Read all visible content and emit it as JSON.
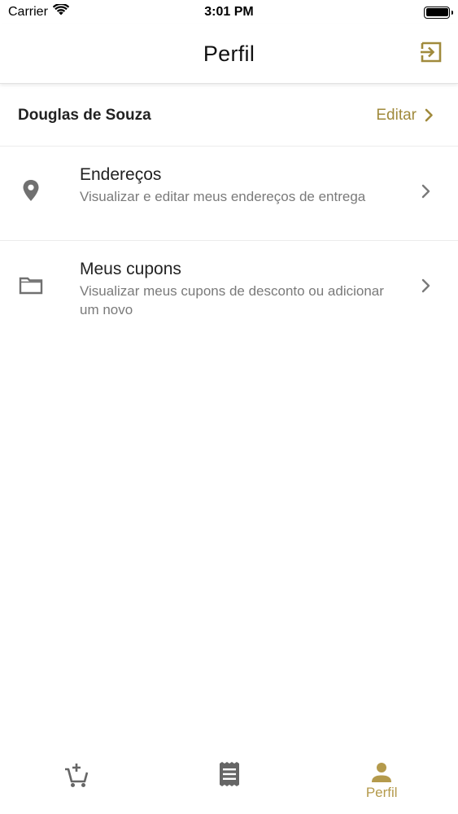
{
  "status_bar": {
    "carrier": "Carrier",
    "time": "3:01 PM"
  },
  "header": {
    "title": "Perfil",
    "logout_icon": "logout-icon"
  },
  "profile": {
    "name": "Douglas de Souza",
    "edit_label": "Editar"
  },
  "menu": [
    {
      "title": "Endereços",
      "description": "Visualizar e editar meus endereços de entrega",
      "icon": "location-pin-icon"
    },
    {
      "title": "Meus cupons",
      "description": "Visualizar meus cupons de desconto ou adicionar um novo",
      "icon": "folder-icon"
    }
  ],
  "tab_bar": {
    "tabs": [
      {
        "icon": "add-to-cart-icon",
        "label": ""
      },
      {
        "icon": "receipt-icon",
        "label": ""
      },
      {
        "icon": "person-icon",
        "label": "Perfil"
      }
    ]
  },
  "colors": {
    "accent": "#a08a3c",
    "tab_active": "#b49a4c",
    "icon_gray": "#707070",
    "text_secondary": "#7a7a7a"
  }
}
